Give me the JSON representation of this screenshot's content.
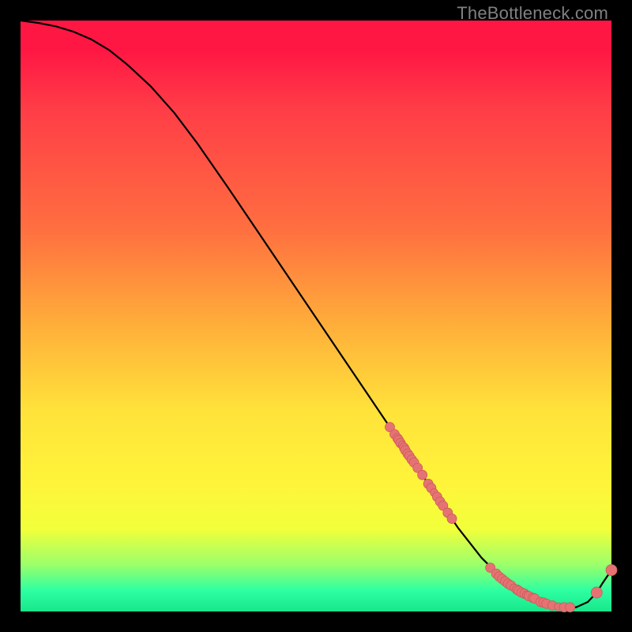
{
  "watermark": "TheBottleneck.com",
  "colors": {
    "dot_fill": "#e57373",
    "dot_stroke": "#cc5a5a",
    "curve": "#000000"
  },
  "chart_data": {
    "type": "line",
    "title": "",
    "xlabel": "",
    "ylabel": "",
    "xlim": [
      0,
      100
    ],
    "ylim": [
      0,
      100
    ],
    "grid": false,
    "legend": false,
    "series": [
      {
        "name": "curve",
        "x": [
          0,
          3,
          6,
          9,
          12,
          15,
          18,
          22,
          26,
          30,
          35,
          40,
          45,
          50,
          55,
          60,
          65,
          70,
          74,
          78,
          82,
          85,
          88,
          90,
          92,
          94,
          96,
          97.5,
          98.5,
          100
        ],
        "y": [
          100,
          99.6,
          99,
          98.1,
          96.8,
          95,
          92.6,
          88.9,
          84.4,
          79.1,
          71.9,
          64.5,
          57.1,
          49.7,
          42.3,
          34.9,
          27.5,
          20.1,
          14.2,
          9.1,
          5.1,
          3.0,
          1.6,
          1.0,
          0.7,
          0.7,
          1.6,
          3.2,
          4.8,
          7.0
        ]
      }
    ],
    "points": {
      "name": "markers",
      "x": [
        62.5,
        63.3,
        63.8,
        64.0,
        64.3,
        64.6,
        64.9,
        65.1,
        65.5,
        65.8,
        66.2,
        66.6,
        67.2,
        68.0,
        69.0,
        69.5,
        70.0,
        70.5,
        71.0,
        71.5,
        72.3,
        73.0,
        79.5,
        80.5,
        81.0,
        81.5,
        82.0,
        82.5,
        83.0,
        83.5,
        84.0,
        84.3,
        84.8,
        85.3,
        85.6,
        86.0,
        86.7,
        87.0,
        88.0,
        88.5,
        89.0,
        90.0,
        91.0,
        92.0,
        93.0,
        97.5,
        100.0
      ],
      "y": [
        31.2,
        30.0,
        29.3,
        29.0,
        28.5,
        28.2,
        27.7,
        27.3,
        26.7,
        26.3,
        25.7,
        25.2,
        24.3,
        23.1,
        21.6,
        20.9,
        20.1,
        19.4,
        18.6,
        17.9,
        16.7,
        15.7,
        7.4,
        6.4,
        5.9,
        5.5,
        5.1,
        4.7,
        4.4,
        4.0,
        3.7,
        3.5,
        3.2,
        3.0,
        2.8,
        2.6,
        2.3,
        2.2,
        1.6,
        1.5,
        1.3,
        1.0,
        0.8,
        0.7,
        0.7,
        3.2,
        7.0
      ],
      "r": [
        6,
        6,
        6,
        6,
        6,
        5,
        6,
        6,
        6,
        6,
        6,
        6,
        6,
        6,
        6,
        6,
        5,
        6,
        6,
        6,
        6,
        6,
        6,
        6,
        6,
        6,
        6,
        6,
        6,
        5,
        6,
        6,
        6,
        6,
        5,
        6,
        6,
        6,
        6,
        6,
        6,
        6,
        5,
        6,
        6,
        7,
        7
      ]
    }
  }
}
